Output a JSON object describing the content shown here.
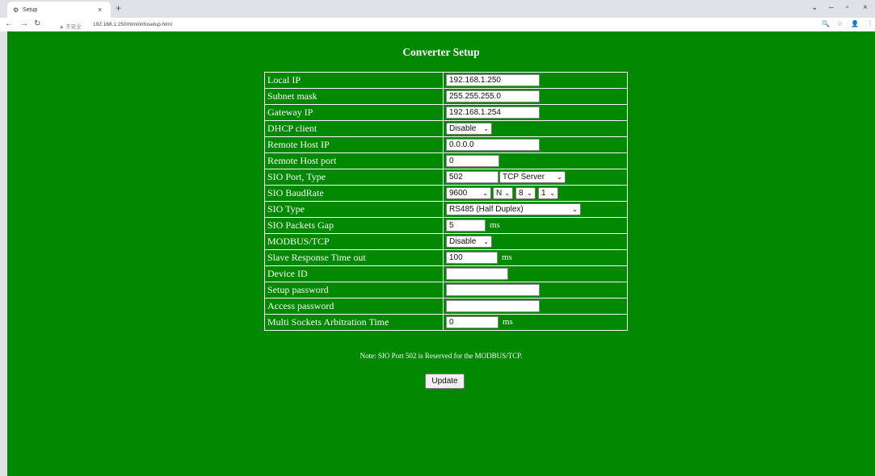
{
  "browser": {
    "tab_title": "Setup",
    "security_label": "▲ 不安全",
    "url": "192.168.1.250/html/infosetup.html"
  },
  "page": {
    "title": "Converter Setup",
    "note": "Note: SIO Port 502 is Reserved for the MODBUS/TCP.",
    "update_label": "Update"
  },
  "rows": [
    {
      "label": "Local IP",
      "value": "192.168.1.250"
    },
    {
      "label": "Subnet mask",
      "value": "255.255.255.0"
    },
    {
      "label": "Gateway IP",
      "value": "192.168.1.254"
    },
    {
      "label": "DHCP client",
      "selected": "Disable"
    },
    {
      "label": "Remote Host IP",
      "value": "0.0.0.0"
    },
    {
      "label": "Remote Host port",
      "value": "0"
    },
    {
      "label": "SIO Port, Type",
      "port": "502",
      "type": "TCP Server"
    },
    {
      "label": "SIO BaudRate",
      "baud": "9600",
      "parity": "N",
      "databits": "8",
      "stopbits": "1"
    },
    {
      "label": "SIO Type",
      "selected": "RS485 (Half Duplex)"
    },
    {
      "label": "SIO Packets Gap",
      "value": "5",
      "unit": "ms"
    },
    {
      "label": "MODBUS/TCP",
      "selected": "Disable"
    },
    {
      "label": "Slave Response Time out",
      "value": "100",
      "unit": "ms"
    },
    {
      "label": "Device ID",
      "value": ""
    },
    {
      "label": "Setup password",
      "value": ""
    },
    {
      "label": "Access password",
      "value": ""
    },
    {
      "label": "Multi Sockets Arbitration Time",
      "value": "0",
      "unit": "ms"
    }
  ]
}
